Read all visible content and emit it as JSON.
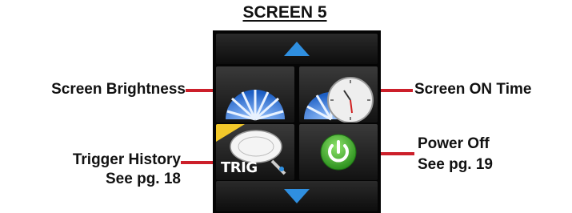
{
  "title": "SCREEN 5",
  "labels": {
    "brightness": "Screen Brightness",
    "on_time": "Screen ON Time",
    "trigger_history_line1": "Trigger History",
    "trigger_history_line2": "See pg. 18",
    "power_off_line1": "Power Off",
    "power_off_line2": "See pg. 19"
  },
  "tiles": {
    "trigger_text": "TRIG"
  },
  "icons": {
    "up": "up-arrow-icon",
    "down": "down-arrow-icon",
    "brightness": "brightness-fan-icon",
    "on_time": "clock-icon",
    "trigger": "trigger-history-icon",
    "power": "power-icon"
  },
  "colors": {
    "leader": "#cc1f2a",
    "arrow": "#2f8fe0",
    "fan": "#2c6fd1",
    "power": "#3fae2a"
  }
}
